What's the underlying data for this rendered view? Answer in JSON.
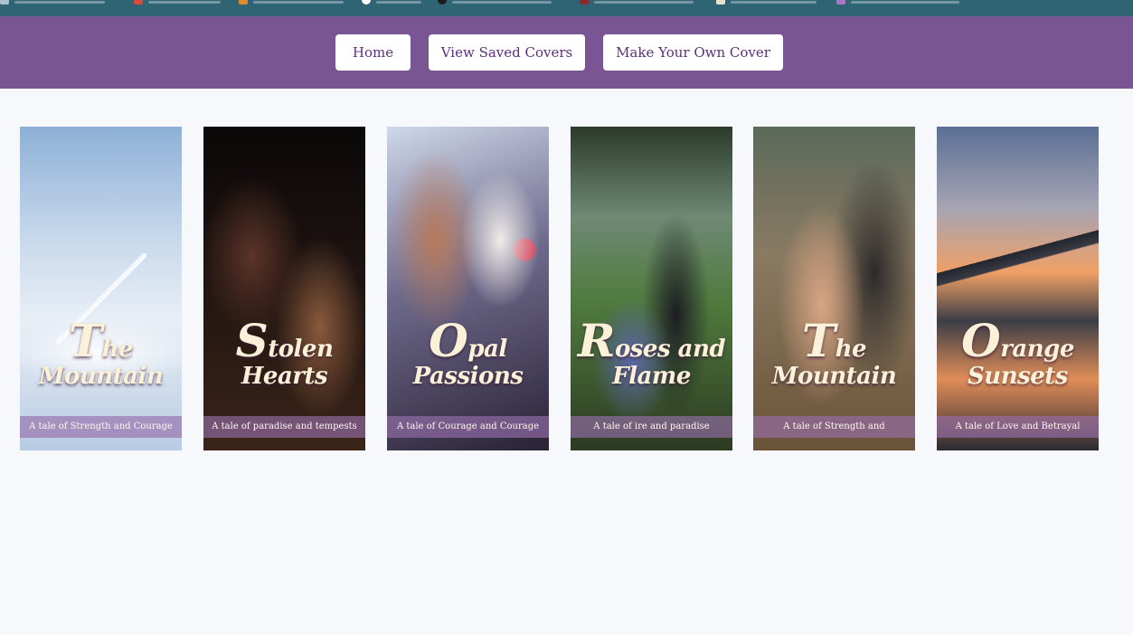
{
  "bookmarks": [
    {
      "icon": "bookmark-folder-icon"
    },
    {
      "icon": "bookmark-red-icon"
    },
    {
      "icon": "bookmark-orange-icon"
    },
    {
      "icon": "bookmark-github-icon"
    },
    {
      "icon": "bookmark-dark-icon"
    },
    {
      "icon": "bookmark-red-square-icon"
    },
    {
      "icon": "bookmark-calendar-icon"
    },
    {
      "icon": "bookmark-purple-icon"
    }
  ],
  "nav": {
    "home_label": "Home",
    "saved_label": "View Saved Covers",
    "make_label": "Make Your Own Cover"
  },
  "covers": [
    {
      "title_first": "T",
      "title_rest": "he",
      "title_line2": "Mountain",
      "tagline": "A tale of Strength and Courage"
    },
    {
      "title_first": "S",
      "title_rest": "tolen",
      "title_line2": "Hearts",
      "tagline": "A tale of paradise and tempests"
    },
    {
      "title_first": "O",
      "title_rest": "pal",
      "title_line2": "Passions",
      "tagline": "A tale of Courage and Courage"
    },
    {
      "title_first": "R",
      "title_rest": "oses and",
      "title_line2": "Flame",
      "tagline": "A tale of ire and paradise"
    },
    {
      "title_first": "T",
      "title_rest": "he",
      "title_line2": "Mountain",
      "tagline": "A tale of Strength and"
    },
    {
      "title_first": "O",
      "title_rest": "range",
      "title_line2": "Sunsets",
      "tagline": "A tale of Love and Betrayal"
    }
  ],
  "colors": {
    "nav_background": "#7a5594",
    "button_text": "#5e2f7e",
    "page_background": "#f7f8fc"
  }
}
